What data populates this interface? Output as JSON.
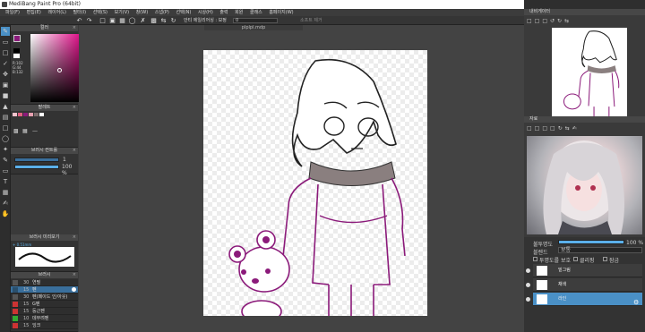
{
  "app": {
    "title": "MediBang Paint Pro (64bit)"
  },
  "menu": [
    "파일(F)",
    "편집(E)",
    "레이어(L)",
    "필터(I)",
    "선택(S)",
    "보기(V)",
    "창(W)",
    "스냅(P)",
    "선택(N)",
    "시상(H)",
    "출력",
    "회원",
    "클래스",
    "홈페이지(W)"
  ],
  "toolbar": {
    "aa_label": "안티 에일리어싱 : 보정",
    "aa_value": "0",
    "transform": "소프트 제거"
  },
  "document": {
    "tab": "plplpl.mdp"
  },
  "panels": {
    "color": {
      "title": "컬러",
      "r": "R:102",
      "g": "G:44",
      "b": "B:132"
    },
    "palette": {
      "title": "팔레트"
    },
    "brushsize": {
      "title": "브러시 컨트롤",
      "size_value": "1",
      "opacity_value": "100 %"
    },
    "brush": {
      "title": "브러시 미리보기",
      "size_text": "+ 0.51mm"
    },
    "layers_left": {
      "title": "브러시",
      "rows": [
        {
          "num": "30",
          "name": "연필"
        },
        {
          "num": "15",
          "name": "펜"
        },
        {
          "num": "30",
          "name": "펜(페이드 인/아웃)"
        },
        {
          "num": "15",
          "name": "G펜"
        },
        {
          "num": "15",
          "name": "둥근펜"
        },
        {
          "num": "10",
          "name": "데무려펜"
        },
        {
          "num": "15",
          "name": "잉크"
        }
      ]
    },
    "navigator": {
      "title": "내비게이터"
    },
    "reference": {
      "title": "자료"
    },
    "layers_right": {
      "opacity_label": "불투명도",
      "opacity_value": "100 %",
      "blend_label": "블렌드",
      "blend_value": "보통",
      "protect_label": "투명도를 보호",
      "clip_label": "클리핑",
      "mask_label": "잠금",
      "rows": [
        {
          "name": "밑그림"
        },
        {
          "name": "채색"
        },
        {
          "name": "라인"
        }
      ]
    }
  },
  "colors": {
    "accent": "#4a90c6",
    "line": "#8b1a7a",
    "sketch": "#222222",
    "scarf": "#7a6b6b"
  }
}
